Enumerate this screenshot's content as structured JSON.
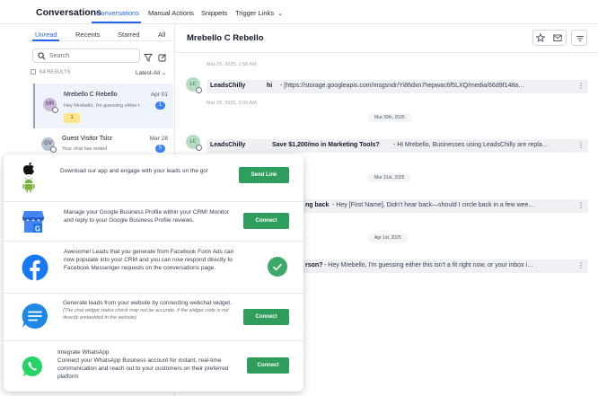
{
  "topnav": {
    "title": "Conversations",
    "tabs": [
      {
        "label": "Conversations",
        "active": true
      },
      {
        "label": "Manual Actions"
      },
      {
        "label": "Snippets"
      },
      {
        "label": "Trigger Links"
      }
    ]
  },
  "list": {
    "tabs": [
      "Unread",
      "Recents",
      "Starred",
      "All"
    ],
    "search_placeholder": "Search",
    "results": "54 RESULTS",
    "sort": "Latest-All",
    "conversations": [
      {
        "initials": "MR",
        "name": "Mrebello C Rebello",
        "date": "Apr 01",
        "preview": "Hey Mrebello,  I'm guessing either t",
        "count": "1",
        "tag": "1"
      },
      {
        "initials": "GV",
        "name": "Guest Visitor Tslcr",
        "date": "Mar 28",
        "preview": "Your chat has ended",
        "count": "5"
      }
    ]
  },
  "chat": {
    "contact": "Mrebello C Rebello",
    "timestamps": [
      "Mar 29, 2025, 1:58 AM",
      "Mar 29, 2025, 2:00 AM"
    ],
    "messages": [
      {
        "sender": "LeadsChilly",
        "subject": "hi",
        "text": "-  [https://storage.googleapis.com/msgsndr/Yi86dxn7hepwac6f5LXQ/media/66d9f148a…",
        "avatar": "LC"
      },
      {
        "sender": "LeadsChilly",
        "subject": "Save $1,200/mo in Marketing Tools?",
        "text": "-  Hi Mrebello, Businesses using LeadsChilly are repla…",
        "avatar": "LC"
      },
      {
        "subject": "ng back",
        "text": "-  Hey [First Name],  Didn't hear back—should I circle back in a few wee…"
      },
      {
        "subject": "rson?",
        "text": "-  Hey Mrebello,  I'm guessing either this isn't a fit right now, or your inbox i…"
      }
    ],
    "dates": [
      "Mar 30th, 2025",
      "Mar 31st, 2025",
      "Apr 1st, 2025"
    ]
  },
  "overlay": {
    "rows": [
      {
        "text": "Download our app and engage with your leads on the go!",
        "button": "Send Link",
        "icon": "apple-android-icon"
      },
      {
        "text": "Manage your Google Business Profile within your CRM! Monitor and reply to your Google Business Profile reviews.",
        "button": "Connect",
        "icon": "google-business-icon"
      },
      {
        "text": "Awesome! Leads that you generate from Facebook Form Ads can now populate into your CRM and you can now respond directly to Facebook Messenger requests on the conversations page.",
        "icon": "facebook-icon"
      },
      {
        "text": "Generate leads from your website by connecting webchat widget.",
        "note": "(The chat widget status check may not be accurate, if the widget code is not directly embedded in the website)",
        "button": "Connect",
        "icon": "webchat-icon"
      },
      {
        "title": "Integrate WhatsApp",
        "text": "Connect your WhatsApp Business account for instant, real-time communication and reach out to your customers on their preferred platform",
        "button": "Connect",
        "icon": "whatsapp-icon"
      }
    ]
  },
  "colors": {
    "accent": "#2563eb",
    "green": "#2f9d5c",
    "unread_badge": "#3b82f6"
  }
}
